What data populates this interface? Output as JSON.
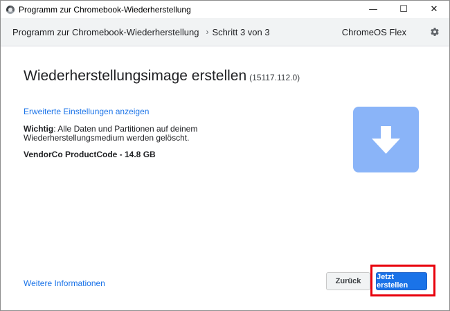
{
  "window": {
    "title": "Programm zur Chromebook-Wiederherstellung",
    "controls": {
      "minimize": "—",
      "maximize": "☐",
      "close": "✕"
    }
  },
  "header": {
    "app_name": "Programm zur Chromebook-Wiederherstellung",
    "separator": "›",
    "step": "Schritt 3 von 3",
    "product": "ChromeOS Flex",
    "settings_icon": "gear-icon"
  },
  "main": {
    "title": "Wiederherstellungsimage erstellen",
    "version": "(15117.112.0)",
    "advanced_link": "Erweiterte Einstellungen anzeigen",
    "warning_label": "Wichtig",
    "warning_text": ": Alle Daten und Partitionen auf deinem Wiederherstellungsmedium werden gelöscht.",
    "device": "VendorCo ProductCode - 14.8 GB",
    "icon": "download-arrow-icon",
    "icon_color": "#8ab4f8"
  },
  "footer": {
    "more_info_link": "Weitere Informationen",
    "back_button": "Zurück",
    "create_button": "Jetzt erstellen",
    "highlight_color": "#e8000b",
    "accent_color": "#1a73e8"
  }
}
